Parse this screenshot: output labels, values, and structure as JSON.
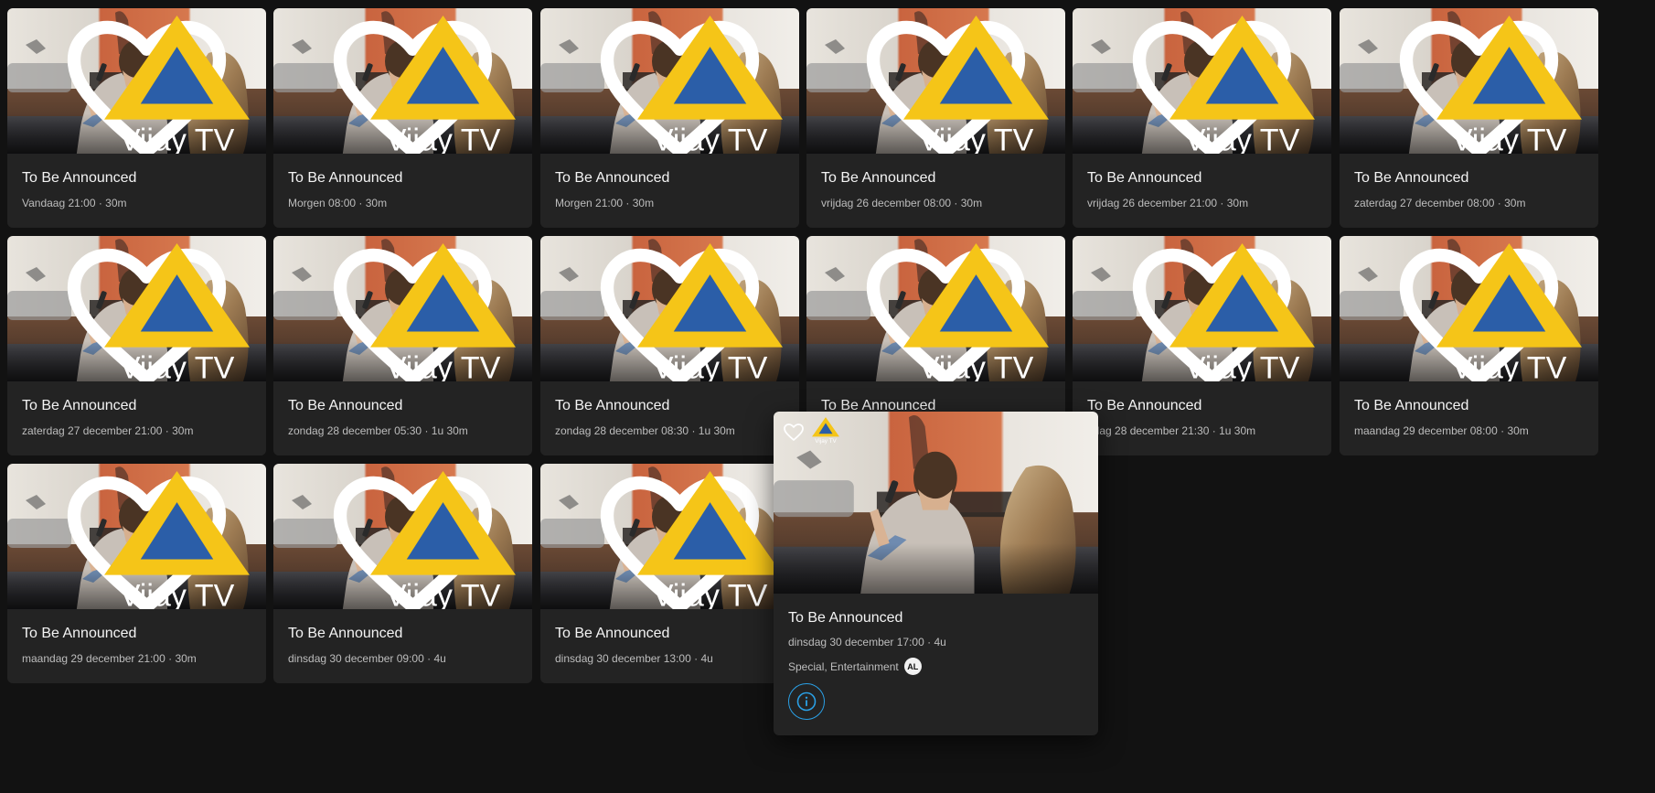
{
  "channel": {
    "name": "Vijay TV",
    "logo_icon": "vijay-tv-logo-icon",
    "accent": "#f5c518"
  },
  "cards": [
    {
      "title": "To Be Announced",
      "meta": "Vandaag 21:00 · 30m"
    },
    {
      "title": "To Be Announced",
      "meta": "Morgen 08:00 · 30m"
    },
    {
      "title": "To Be Announced",
      "meta": "Morgen 21:00 · 30m"
    },
    {
      "title": "To Be Announced",
      "meta": "vrijdag 26 december 08:00 · 30m"
    },
    {
      "title": "To Be Announced",
      "meta": "vrijdag 26 december 21:00 · 30m"
    },
    {
      "title": "To Be Announced",
      "meta": "zaterdag 27 december 08:00 · 30m"
    },
    {
      "title": "To Be Announced",
      "meta": "zaterdag 27 december 21:00 · 30m"
    },
    {
      "title": "To Be Announced",
      "meta": "zondag 28 december 05:30 · 1u 30m"
    },
    {
      "title": "To Be Announced",
      "meta": "zondag 28 december 08:30 · 1u 30m"
    },
    {
      "title": "To Be Announced",
      "meta": ""
    },
    {
      "title": "To Be Announced",
      "meta": "ndag 28 december 21:30 · 1u 30m"
    },
    {
      "title": "To Be Announced",
      "meta": "maandag 29 december 08:00 · 30m"
    },
    {
      "title": "To Be Announced",
      "meta": "maandag 29 december 21:00 · 30m"
    },
    {
      "title": "To Be Announced",
      "meta": "dinsdag 30 december 09:00 · 4u"
    },
    {
      "title": "To Be Announced",
      "meta": "dinsdag 30 december 13:00 · 4u"
    }
  ],
  "popup": {
    "title": "To Be Announced",
    "meta": "dinsdag 30 december 17:00 · 4u",
    "genres": "Special, Entertainment",
    "rating": "AL",
    "info_icon": "info-icon",
    "info_color": "#2aa0e6"
  }
}
